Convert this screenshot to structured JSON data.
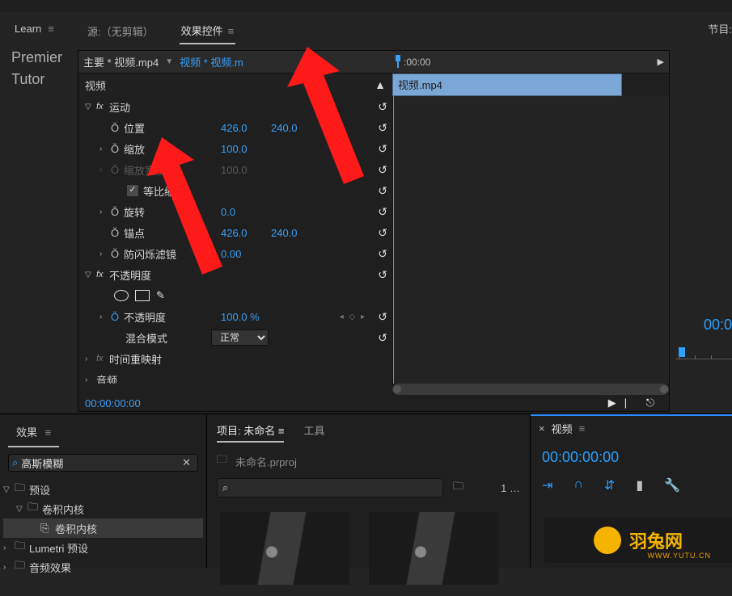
{
  "learn": "Learn",
  "left_col": [
    "Premier",
    "Tutor"
  ],
  "tabs": {
    "source": "源:（无剪辑）",
    "effects": "效果控件",
    "project_right": "节目:"
  },
  "crumb": {
    "main": "主要 * 视频.mp4",
    "sub": "视频 * 视频.m"
  },
  "timeline_head": ":00:00",
  "clip_name": "视频.mp4",
  "section_video": "视频",
  "motion": {
    "name": "运动",
    "position": {
      "label": "位置",
      "x": "426.0",
      "y": "240.0"
    },
    "scale": {
      "label": "缩放",
      "v": "100.0"
    },
    "scalew": {
      "label": "缩放宽度",
      "v": "100.0"
    },
    "uniform": "等比缩放",
    "rotation": {
      "label": "旋转",
      "v": "0.0"
    },
    "anchor": {
      "label": "锚点",
      "x": "426.0",
      "y": "240.0"
    },
    "flicker": {
      "label": "防闪烁滤镜",
      "v": "0.00"
    }
  },
  "opacity": {
    "name": "不透明度",
    "value_label": "不透明度",
    "value": "100.0 %",
    "blend_label": "混合模式",
    "blend_value": "正常"
  },
  "time_remap": "时间重映射",
  "section_audio": "音频",
  "timecode": "00:00:00:00",
  "effects_panel": {
    "title": "效果",
    "search": "高斯模糊",
    "tree": [
      "预设",
      "卷积内核",
      "卷积内核",
      "Lumetri 预设",
      "音频效果"
    ]
  },
  "project_panel": {
    "tab_project": "项目: 未命名",
    "tab_tools": "工具",
    "file": "未命名.prproj",
    "count": "1 …"
  },
  "video_panel": {
    "title": "视频",
    "tc": "00:00:00:00"
  },
  "logo": {
    "text": "羽兔网",
    "sub": "WWW.YUTU.CN"
  },
  "right_tc": "00:0"
}
